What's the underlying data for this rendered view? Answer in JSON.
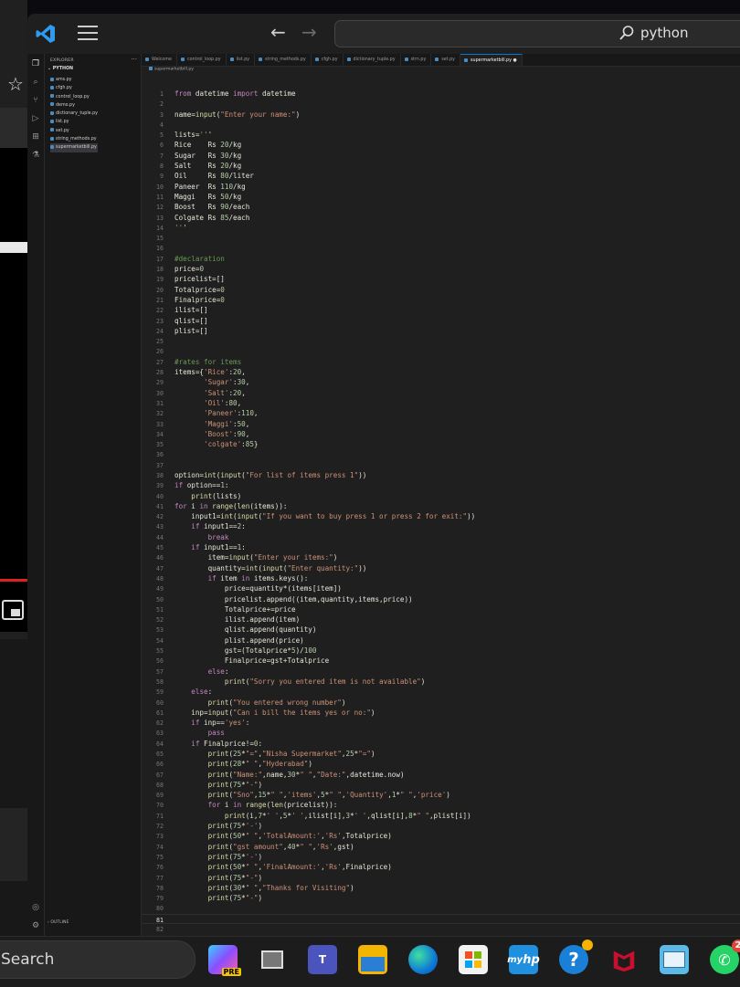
{
  "titlebar": {
    "search_text": "python"
  },
  "explorer": {
    "title": "EXPLORER",
    "folder": "PYTHON",
    "files": [
      "ams.py",
      "cfgh.py",
      "control_loop.py",
      "demo.py",
      "dictionary_tuple.py",
      "list.py",
      "set.py",
      "string_methods.py",
      "supermarketbill.py"
    ],
    "outline": "OUTLINE"
  },
  "tabs": [
    {
      "label": "Welcome",
      "active": false
    },
    {
      "label": "control_loop.py",
      "active": false
    },
    {
      "label": "list.py",
      "active": false
    },
    {
      "label": "string_methods.py",
      "active": false
    },
    {
      "label": "cfgh.py",
      "active": false
    },
    {
      "label": "dictionary_tuple.py",
      "active": false
    },
    {
      "label": "strn.py",
      "active": false
    },
    {
      "label": "set.py",
      "active": false
    },
    {
      "label": "supermarketbill.py",
      "active": true
    }
  ],
  "breadcrumb": "supermarketbill.py",
  "code_lines": [
    "from datetime import datetime",
    "",
    "name=input(\"Enter your name:\")",
    "",
    "lists='''",
    "Rice    Rs 20/kg",
    "Sugar   Rs 30/kg",
    "Salt    Rs 20/kg",
    "Oil     Rs 80/liter",
    "Paneer  Rs 110/kg",
    "Maggi   Rs 50/kg",
    "Boost   Rs 90/each",
    "Colgate Rs 85/each",
    "'''",
    "",
    "",
    "#declaration",
    "price=0",
    "pricelist=[]",
    "Totalprice=0",
    "Finalprice=0",
    "ilist=[]",
    "qlist=[]",
    "plist=[]",
    "",
    "",
    "#rates for items",
    "items={'Rice':20,",
    "       'Sugar':30,",
    "       'Salt':20,",
    "       'Oil':80,",
    "       'Paneer':110,",
    "       'Maggi':50,",
    "       'Boost':90,",
    "       'colgate':85}",
    "",
    "",
    "option=int(input(\"For list of items press 1\"))",
    "if option==1:",
    "    print(lists)",
    "for i in range(len(items)):",
    "    input1=int(input(\"If you want to buy press 1 or press 2 for exit:\"))",
    "    if input1==2:",
    "        break",
    "    if input1==1:",
    "        item=input(\"Enter your items:\")",
    "        quantity=int(input(\"Enter quantity:\"))",
    "        if item in items.keys():",
    "            price=quantity*(items[item])",
    "            pricelist.append((item,quantity,items,price))",
    "            Totalprice+=price",
    "            ilist.append(item)",
    "            qlist.append(quantity)",
    "            plist.append(price)",
    "            gst=(Totalprice*5)/100",
    "            Finalprice=gst+Totalprice",
    "        else:",
    "            print(\"Sorry you entered item is not available\")",
    "    else:",
    "        print(\"You entered wrong number\")",
    "    inp=input(\"Can i bill the items yes or no:\")",
    "    if inp=='yes':",
    "        pass",
    "    if Finalprice!=0:",
    "        print(25*\"=\",\"Nisha Supermarket\",25*\"=\")",
    "        print(28*\" \",\"Hyderabad\")",
    "        print(\"Name:\",name,30*\" \",\"Date:\",datetime.now)",
    "        print(75*\"-\")",
    "        print(\"Sno\",15*\" \",'items',5*\" \",'Quantity',1*\" \",'price')",
    "        for i in range(len(pricelist)):",
    "            print(i,7*' ',5*' ',ilist[i],3*' ',qlist[i],8*\" \",plist[i])",
    "        print(75*'-')",
    "        print(50*\" \",'TotalAmount:','Rs',Totalprice)",
    "        print(\"gst amount\",40*\" \",'Rs',gst)",
    "        print(75*'-')",
    "        print(50*\" \",'FinalAmount:','Rs',Finalprice)",
    "        print(75*\"-\")",
    "        print(30*\" \",\"Thanks for Visiting\")",
    "        print(75*\"-\")",
    "",
    "",
    ""
  ],
  "current_line": 81,
  "taskbar": {
    "search_label": "Search",
    "whatsapp_badge": "2"
  }
}
